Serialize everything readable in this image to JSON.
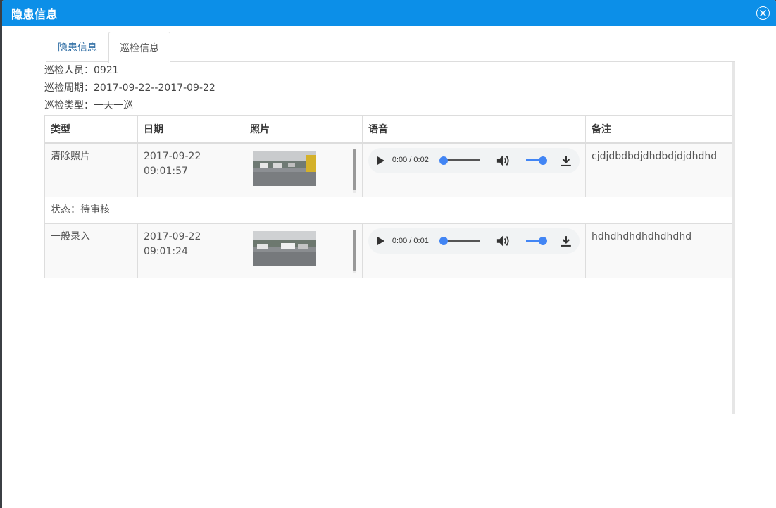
{
  "dialog": {
    "title": "隐患信息"
  },
  "tabs": [
    {
      "label": "隐患信息"
    },
    {
      "label": "巡检信息"
    }
  ],
  "info": {
    "inspector": "巡检人员：0921",
    "period": "巡检周期：2017-09-22--2017-09-22",
    "type": "巡检类型：一天一巡"
  },
  "table": {
    "headers": [
      "类型",
      "日期",
      "照片",
      "语音",
      "备注"
    ],
    "rows": [
      {
        "type": "清除照片",
        "date": "2017-09-22",
        "time": "09:01:57",
        "audio_time": "0:00 / 0:02",
        "note": "cjdjdbdbdjdhdbdjdjdhdhd"
      },
      {
        "type": "一般录入",
        "date": "2017-09-22",
        "time": "09:01:24",
        "audio_time": "0:00 / 0:01",
        "note": "hdhdhdhdhdhdhdhd"
      }
    ],
    "status": "状态：待审核"
  },
  "icons": {
    "close": "close-circle-icon",
    "play": "play-icon",
    "speaker": "speaker-icon",
    "download": "download-icon"
  },
  "colors": {
    "titlebar": "#0c8fe8",
    "tab_link": "#2e6da4",
    "audio_accent": "#4285f4"
  }
}
